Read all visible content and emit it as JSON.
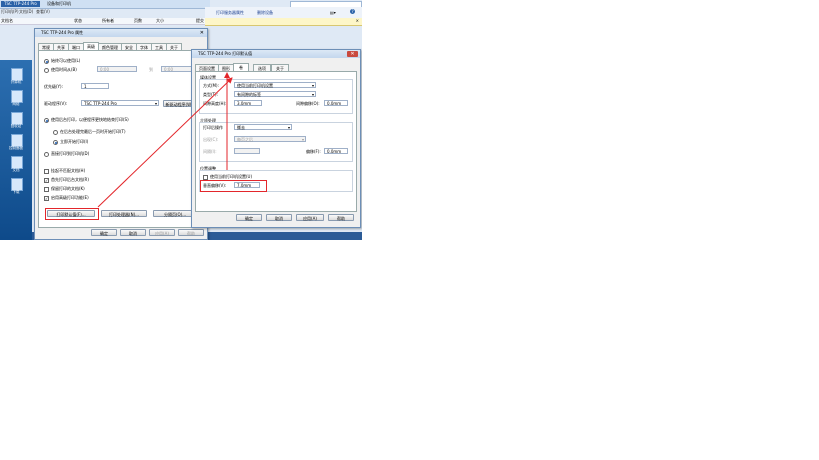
{
  "explorer": {
    "tabs": [
      "TSC TTP-244 Pro",
      "设备和打印机"
    ],
    "menu": [
      "打印机(P)",
      "文档(D)",
      "查看(V)"
    ],
    "columns": [
      "文档名",
      "状态",
      "所有者",
      "页数",
      "大小",
      "提交"
    ]
  },
  "browser": {
    "links": [
      "打印服务器属性",
      "删除设备"
    ]
  },
  "desktop_icons": [
    "计算机",
    "网络",
    "回收站",
    "控制面板",
    "文档",
    "下载"
  ],
  "properties_window": {
    "title": "TSC TTP-244 Pro 属性",
    "tabs": [
      "常规",
      "共享",
      "端口",
      "高级",
      "颜色管理",
      "安全",
      "字体",
      "工具",
      "关于"
    ],
    "always_available": "始终可以使用(L)",
    "available_from": "使用时间从(B)",
    "time_from": "0:00",
    "to_label": "到",
    "time_to": "0:00",
    "priority_label": "优先级(Y):",
    "priority_value": "1",
    "driver_label": "驱动程序(V):",
    "driver_value": "TSC TTP-244 Pro",
    "new_driver_button": "新驱动程序(W)...",
    "spool_option": "使用后台打印，以便程序更快地结束打印(S)",
    "spool_after_last": "在后台处理完最后一页时开始打印(T)",
    "spool_immediately": "立即开始打印(I)",
    "direct_print": "直接打印到打印机(D)",
    "hold_mismatched": "挂起不匹配文档(H)",
    "print_spooled_first": "首先打印后台文档(R)",
    "keep_printed": "保留打印的文档(K)",
    "advanced_features": "启用高级打印功能(E)",
    "defaults_button": "打印默认值(F)...",
    "processor_button": "打印处理器(N)...",
    "separator_button": "分隔页(O)...",
    "ok": "确定",
    "cancel": "取消",
    "apply": "应用(A)",
    "help": "帮助"
  },
  "defaults_window": {
    "title": "TSC TTP-244 Pro 打印默认值",
    "tabs": [
      "页面设置",
      "图形",
      "卷",
      "选项",
      "关于"
    ],
    "media_settings": "媒体设置",
    "method_label": "方式(M):",
    "method_value": "使用当前打印机设置",
    "type_label": "类型(T):",
    "type_value": "有间隙的标签",
    "gap_height_label": "间隙高度(H):",
    "gap_height_value": "3.0mm",
    "gap_offset_label": "间隙偏移(O):",
    "gap_offset_value": "0.0mm",
    "post_print": "介质处理",
    "post_action_label": "打印后操作",
    "post_action_value": "撕去",
    "occurrence_label": "出现(C):",
    "occurrence_value": "每页之后",
    "interval_label": "间隔(I):",
    "offset_label": "偏移(F):",
    "offset_value": "0.0mm",
    "position_adjust": "位置调整",
    "use_current_settings": "使用当前打印机设置(U)",
    "vertical_offset_label": "垂直偏移(V):",
    "vertical_offset_value": "7.0mm",
    "ok": "确定",
    "cancel": "取消",
    "apply": "应用(A)",
    "help": "帮助"
  },
  "colors": {
    "highlight": "#e3262b",
    "title_close": "#c94a3f"
  }
}
